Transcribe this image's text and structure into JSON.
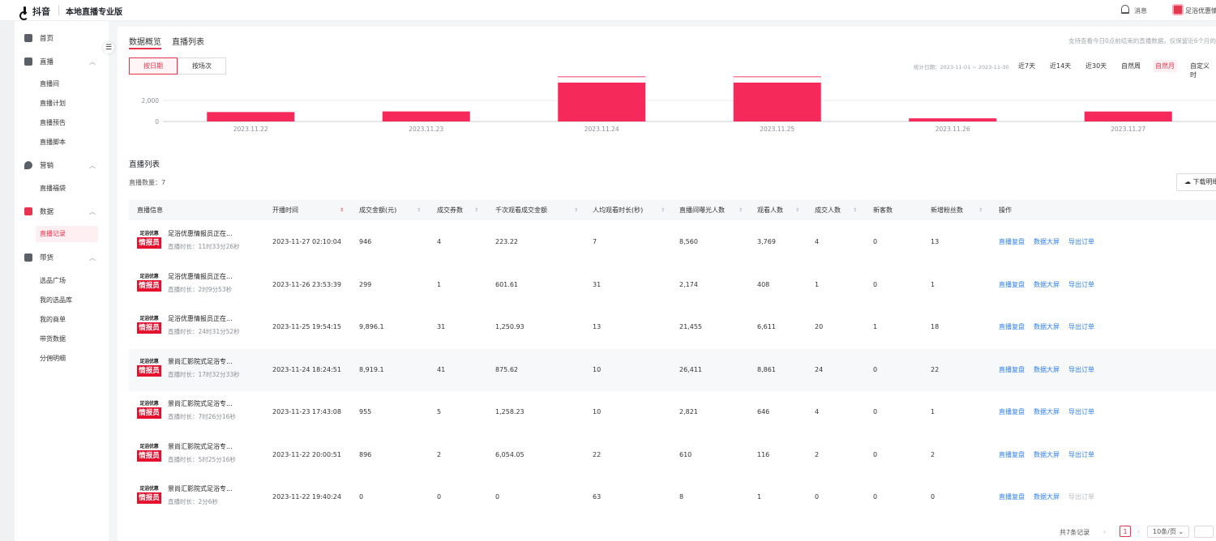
{
  "topbar": {
    "logo": "抖音",
    "product": "本地直播专业版",
    "messages": "消息",
    "account": "足浴优惠情"
  },
  "sidebar": {
    "home": "首页",
    "live": {
      "label": "直播",
      "items": [
        "直播间",
        "直播计划",
        "直播预告",
        "直播脚本"
      ]
    },
    "marketing": {
      "label": "营销",
      "items": [
        "直播福袋"
      ]
    },
    "data": {
      "label": "数据",
      "items": [
        "直播记录"
      ]
    },
    "goods": {
      "label": "带货",
      "items": [
        "选品广场",
        "我的选品库",
        "我的商单",
        "带货数据",
        "分佣明细"
      ]
    }
  },
  "tabs": [
    "数据概览",
    "直播列表"
  ],
  "hint": "支持查看今日0点前结束的直播数据，仅保留近6个月的",
  "segments": [
    "按日期",
    "按场次"
  ],
  "stat_date": "统计日期：2023-11-01 ~ 2023-11-30",
  "ranges": [
    "近7天",
    "近14天",
    "近30天",
    "自然周",
    "自然月",
    "自定义时"
  ],
  "chart_data": {
    "type": "bar",
    "categories": [
      "2023.11.22",
      "2023.11.23",
      "2023.11.24",
      "2023.11.25",
      "2023.11.26",
      "2023.11.27"
    ],
    "values": [
      896,
      955,
      8919.1,
      9896.1,
      299,
      946
    ],
    "yticks": [
      "2,000",
      "0"
    ],
    "ytick_values": [
      2000,
      0
    ],
    "visible_ylim": [
      0,
      3700
    ],
    "bar_color": "#f5295a"
  },
  "list": {
    "title": "直播列表",
    "count": "直播数量：7",
    "download": "下载明细"
  },
  "columns": [
    "直播信息",
    "开播时间",
    "成交金额(元)",
    "成交券数",
    "千次观看成交金额",
    "人均观看时长(秒)",
    "直播间曝光人数",
    "观看人数",
    "成交人数",
    "新客数",
    "新增粉丝数",
    "操作"
  ],
  "rows": [
    {
      "badge_top": "足浴优惠",
      "badge": "情报员",
      "title": "足浴优惠情报员正在...",
      "duration": "直播时长：11时33分26秒",
      "start": "2023-11-27 02:10:04",
      "amount": "946",
      "coupons": "4",
      "gpm": "223.22",
      "avg_watch": "7",
      "exposure": "8,560",
      "viewers": "3,769",
      "buyers": "4",
      "new_customers": "0",
      "new_fans": "13"
    },
    {
      "badge_top": "足浴优惠",
      "badge": "情报员",
      "title": "足浴优惠情报员正在...",
      "duration": "直播时长：2时9分53秒",
      "start": "2023-11-26 23:53:39",
      "amount": "299",
      "coupons": "1",
      "gpm": "601.61",
      "avg_watch": "31",
      "exposure": "2,174",
      "viewers": "408",
      "buyers": "1",
      "new_customers": "0",
      "new_fans": "1"
    },
    {
      "badge_top": "足浴优惠",
      "badge": "情报员",
      "title": "足浴优惠情报员正在...",
      "duration": "直播时长：24时31分52秒",
      "start": "2023-11-25 19:54:15",
      "amount": "9,896.1",
      "coupons": "31",
      "gpm": "1,250.93",
      "avg_watch": "13",
      "exposure": "21,455",
      "viewers": "6,611",
      "buyers": "20",
      "new_customers": "1",
      "new_fans": "18"
    },
    {
      "badge_top": "足浴优惠",
      "badge": "情报员",
      "title": "景尚汇影院式足浴专...",
      "duration": "直播时长：17时32分33秒",
      "start": "2023-11-24 18:24:51",
      "amount": "8,919.1",
      "coupons": "41",
      "gpm": "875.62",
      "avg_watch": "10",
      "exposure": "26,411",
      "viewers": "8,861",
      "buyers": "24",
      "new_customers": "0",
      "new_fans": "22"
    },
    {
      "badge_top": "足浴优惠",
      "badge": "情报员",
      "title": "景尚汇影院式足浴专...",
      "duration": "直播时长：7时26分16秒",
      "start": "2023-11-23 17:43:08",
      "amount": "955",
      "coupons": "5",
      "gpm": "1,258.23",
      "avg_watch": "10",
      "exposure": "2,821",
      "viewers": "646",
      "buyers": "4",
      "new_customers": "0",
      "new_fans": "1"
    },
    {
      "badge_top": "足浴优惠",
      "badge": "情报员",
      "title": "景尚汇影院式足浴专...",
      "duration": "直播时长：5时25分16秒",
      "start": "2023-11-22 20:00:51",
      "amount": "896",
      "coupons": "2",
      "gpm": "6,054.05",
      "avg_watch": "22",
      "exposure": "610",
      "viewers": "116",
      "buyers": "2",
      "new_customers": "0",
      "new_fans": "2"
    },
    {
      "badge_top": "足浴优惠",
      "badge": "情报员",
      "title": "景尚汇影院式足浴专...",
      "duration": "直播时长：2分6秒",
      "start": "2023-11-22 19:40:24",
      "amount": "0",
      "coupons": "0",
      "gpm": "0",
      "avg_watch": "63",
      "exposure": "8",
      "viewers": "1",
      "buyers": "0",
      "new_customers": "0",
      "new_fans": "0"
    }
  ],
  "actions": [
    "直播复盘",
    "数据大屏",
    "导出订单"
  ],
  "pager": {
    "total": "共7条记录",
    "prev": "‹",
    "page": "1",
    "next": "›",
    "size": "10条/页 ⌄"
  }
}
